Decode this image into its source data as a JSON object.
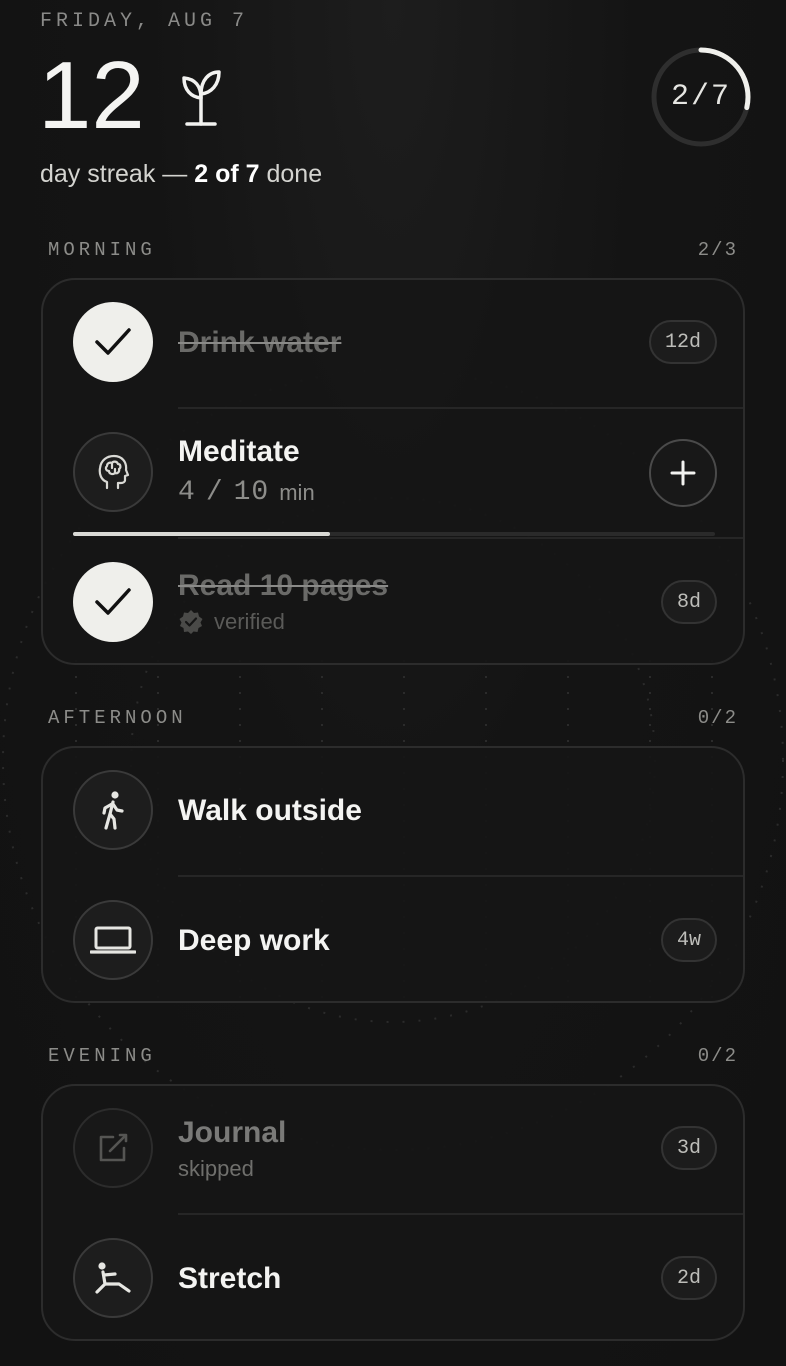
{
  "header": {
    "date": "FRIDAY, AUG 7",
    "streak_number": "12",
    "streak_prefix": "day streak — ",
    "streak_done": "2 of 7",
    "streak_suffix": " done",
    "ring_label": "2/7",
    "ring_progress": 0.2857
  },
  "sections": [
    {
      "label": "MORNING",
      "count": "2/3",
      "items": [
        {
          "title": "Drink water",
          "state": "done",
          "badge": "12d",
          "icon": "check-icon"
        },
        {
          "title": "Meditate",
          "state": "in-progress",
          "progress_current": "4",
          "progress_sep": "/",
          "progress_target": "10",
          "progress_unit": "min",
          "progress_fraction": 0.4,
          "icon": "brain-icon",
          "action": "+"
        },
        {
          "title": "Read 10 pages",
          "state": "done",
          "sub": "verified",
          "badge": "8d",
          "icon": "check-icon"
        }
      ]
    },
    {
      "label": "AFTERNOON",
      "count": "0/2",
      "items": [
        {
          "title": "Walk outside",
          "state": "todo",
          "icon": "walking-icon"
        },
        {
          "title": "Deep work",
          "state": "todo",
          "badge": "4w",
          "icon": "laptop-icon"
        }
      ]
    },
    {
      "label": "EVENING",
      "count": "0/2",
      "items": [
        {
          "title": "Journal",
          "state": "skipped",
          "sub": "skipped",
          "badge": "3d",
          "icon": "journal-icon"
        },
        {
          "title": "Stretch",
          "state": "todo",
          "badge": "2d",
          "icon": "stretch-icon"
        }
      ]
    }
  ],
  "colors": {
    "background": "#141414",
    "card_border": "#2c2c2c",
    "done_circle": "#efefeb",
    "text": "#f4f4f2",
    "muted": "#8c8c89"
  }
}
